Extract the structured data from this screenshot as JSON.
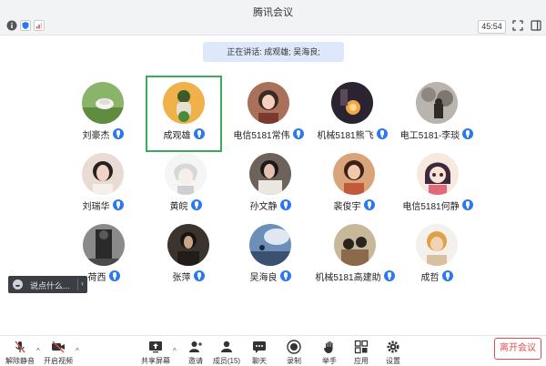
{
  "app": {
    "title": "腾讯会议"
  },
  "topbar": {
    "timer": "45:54"
  },
  "speaking": "正在讲话: 成观雄; 吴海良;",
  "participants": [
    {
      "name": "刘豪杰",
      "active": false
    },
    {
      "name": "成观雄",
      "active": true
    },
    {
      "name": "电信5181常伟",
      "active": false
    },
    {
      "name": "机械5181熊飞",
      "active": false
    },
    {
      "name": "电工5181-李琰",
      "active": false
    },
    {
      "name": "刘瑞华",
      "active": false
    },
    {
      "name": "黄皖",
      "active": false
    },
    {
      "name": "孙文静",
      "active": false
    },
    {
      "name": "裴俊宇",
      "active": false
    },
    {
      "name": "电信5181何静",
      "active": false
    },
    {
      "name": "荷西",
      "active": false
    },
    {
      "name": "张萍",
      "active": false
    },
    {
      "name": "吴海良",
      "active": false
    },
    {
      "name": "机械5181高建助",
      "active": false
    },
    {
      "name": "成哲",
      "active": false
    }
  ],
  "chat": {
    "placeholder": "说点什么..."
  },
  "toolbar": {
    "unmute": "解除静音",
    "video": "开启视频",
    "share": "共享屏幕",
    "invite": "邀请",
    "members": "成员(15)",
    "chat": "聊天",
    "record": "录制",
    "raise": "举手",
    "apps": "应用",
    "settings": "设置",
    "leave": "离开会议"
  },
  "colors": {
    "accent": "#2a79f0",
    "active_border": "#3aab5b",
    "leave": "#e34d4d"
  }
}
